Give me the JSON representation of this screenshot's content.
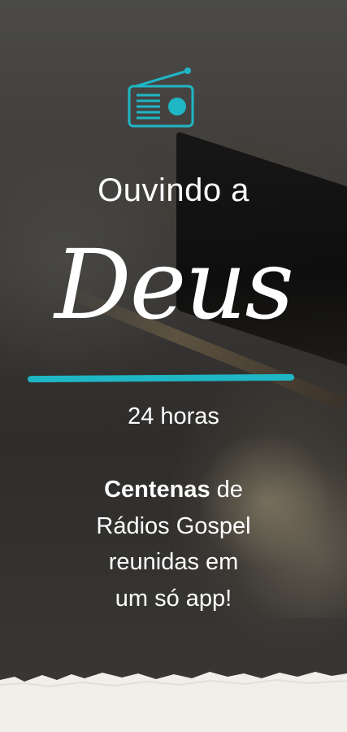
{
  "radio": {
    "icon": "radio-icon",
    "accent": "#1fb6c5"
  },
  "hero": {
    "headline": "Ouvindo a",
    "script_word": "Deus",
    "subline": "24 horas"
  },
  "body": {
    "bold": "Centenas",
    "line1_rest": " de",
    "line2": "Rádios Gospel",
    "line3": "reunidas em",
    "line4": "um só app!"
  }
}
